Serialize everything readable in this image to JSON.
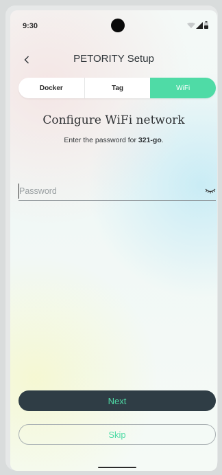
{
  "status_bar": {
    "time": "9:30",
    "icons": [
      "wifi-icon",
      "signal-icon",
      "battery-icon"
    ]
  },
  "header": {
    "back_icon": "chevron-left-icon",
    "title": "PETORITY Setup"
  },
  "tabs": [
    {
      "label": "Docker",
      "active": false
    },
    {
      "label": "Tag",
      "active": false
    },
    {
      "label": "WiFi",
      "active": true
    }
  ],
  "content": {
    "title": "Configure WiFi network",
    "subtitle_prefix": "Enter the password for ",
    "network_name": "321-go",
    "subtitle_suffix": "."
  },
  "password": {
    "placeholder": "Password",
    "value": "",
    "toggle_icon": "eye-closed-icon"
  },
  "actions": {
    "next_label": "Next",
    "skip_label": "Skip"
  },
  "colors": {
    "accent": "#4fdba6",
    "button_dark": "#2f3d45",
    "text": "#2c2f31"
  }
}
